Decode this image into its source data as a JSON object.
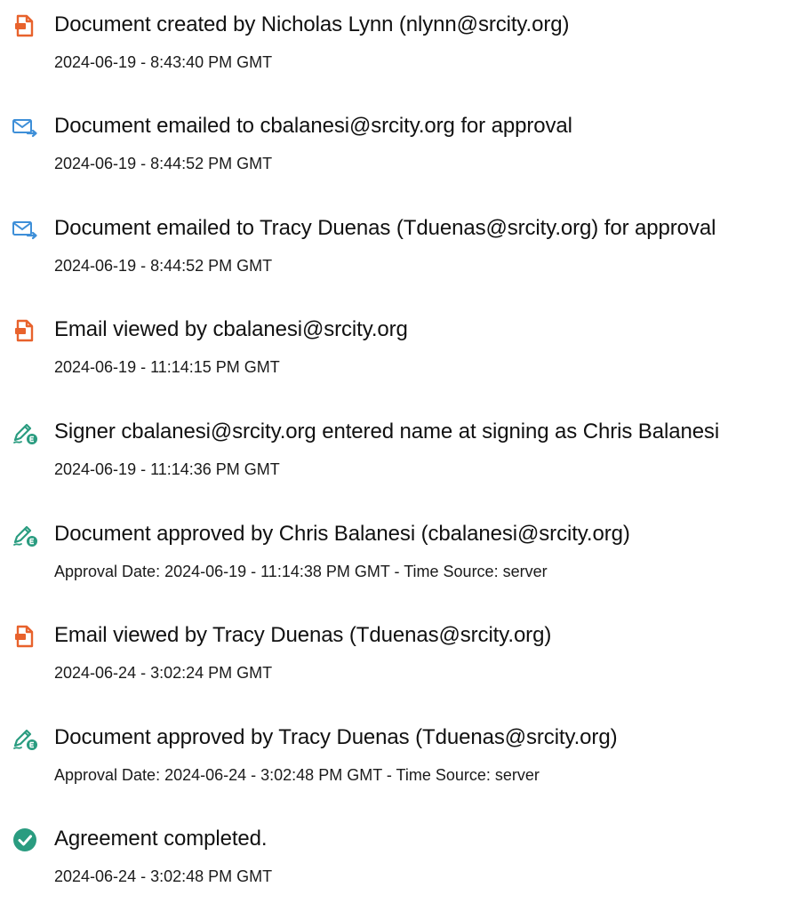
{
  "events": [
    {
      "icon": "document-icon",
      "title": "Document created by Nicholas Lynn (nlynn@srcity.org)",
      "subtitle": "2024-06-19 - 8:43:40 PM GMT"
    },
    {
      "icon": "email-send-icon",
      "title": "Document emailed to cbalanesi@srcity.org for approval",
      "subtitle": "2024-06-19 - 8:44:52 PM GMT"
    },
    {
      "icon": "email-send-icon",
      "title": "Document emailed to Tracy Duenas (Tduenas@srcity.org) for approval",
      "subtitle": "2024-06-19 - 8:44:52 PM GMT"
    },
    {
      "icon": "document-icon",
      "title": "Email viewed by cbalanesi@srcity.org",
      "subtitle": "2024-06-19 - 11:14:15 PM GMT"
    },
    {
      "icon": "pen-sign-icon",
      "title": "Signer cbalanesi@srcity.org entered name at signing as Chris Balanesi",
      "subtitle": "2024-06-19 - 11:14:36 PM GMT"
    },
    {
      "icon": "pen-sign-icon",
      "title": "Document approved by Chris Balanesi (cbalanesi@srcity.org)",
      "subtitle": "Approval Date: 2024-06-19 - 11:14:38 PM GMT - Time Source: server"
    },
    {
      "icon": "document-icon",
      "title": "Email viewed by Tracy Duenas (Tduenas@srcity.org)",
      "subtitle": "2024-06-24 - 3:02:24 PM GMT"
    },
    {
      "icon": "pen-sign-icon",
      "title": "Document approved by Tracy Duenas (Tduenas@srcity.org)",
      "subtitle": "Approval Date: 2024-06-24 - 3:02:48 PM GMT - Time Source: server"
    },
    {
      "icon": "check-circle-icon",
      "title": "Agreement completed.",
      "subtitle": "2024-06-24 - 3:02:48 PM GMT"
    }
  ],
  "colors": {
    "document_icon": "#e8622c",
    "email_icon": "#3e8fd8",
    "pen_icon": "#2a9c80",
    "check_icon": "#2a9c80",
    "text": "#111111"
  }
}
